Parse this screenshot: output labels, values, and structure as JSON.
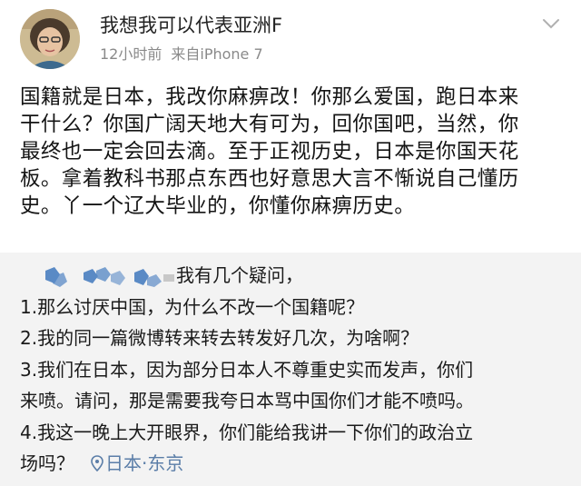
{
  "header": {
    "username": "我想我可以代表亚洲F",
    "time": "12小时前",
    "source": "来自iPhone 7"
  },
  "post": {
    "lines": [
      "国籍就是日本，我改你麻痹改！你那么爱国，跑日本来",
      "干什么？你国广阔天地大有可为，回你国吧，当然，你",
      "最终也一定会回去滴。至于正视历史，日本是你国天花",
      "板。拿着教科书那点东西也好意思大言不惭说自己懂历",
      "史。丫一个辽大毕业的，你懂你麻痹历史。"
    ]
  },
  "repost": {
    "first_line_text": "我有几个疑问，",
    "lines": [
      "1.那么讨厌中国，为什么不改一个国籍呢？",
      "2.我的同一篇微博转来转去转发好几次，为啥啊？",
      "3.我们在日本，因为部分日本人不尊重史实而发声，你们",
      "来喷。请问，那是需要我夸日本骂中国你们才能不喷吗。",
      "4.我这一晚上大开眼界，你们能给我讲一下你们的政治立"
    ],
    "last_line_text": "场吗？",
    "location": "日本·东京"
  },
  "colors": {
    "repost_bg": "#f3f3f3",
    "meta_text": "#8a8a8a",
    "location_text": "#5b7ea8",
    "mosaic_blue": "#4a7fc1"
  },
  "icons": {
    "more": "chevron-down-icon",
    "location": "location-pin-icon"
  }
}
